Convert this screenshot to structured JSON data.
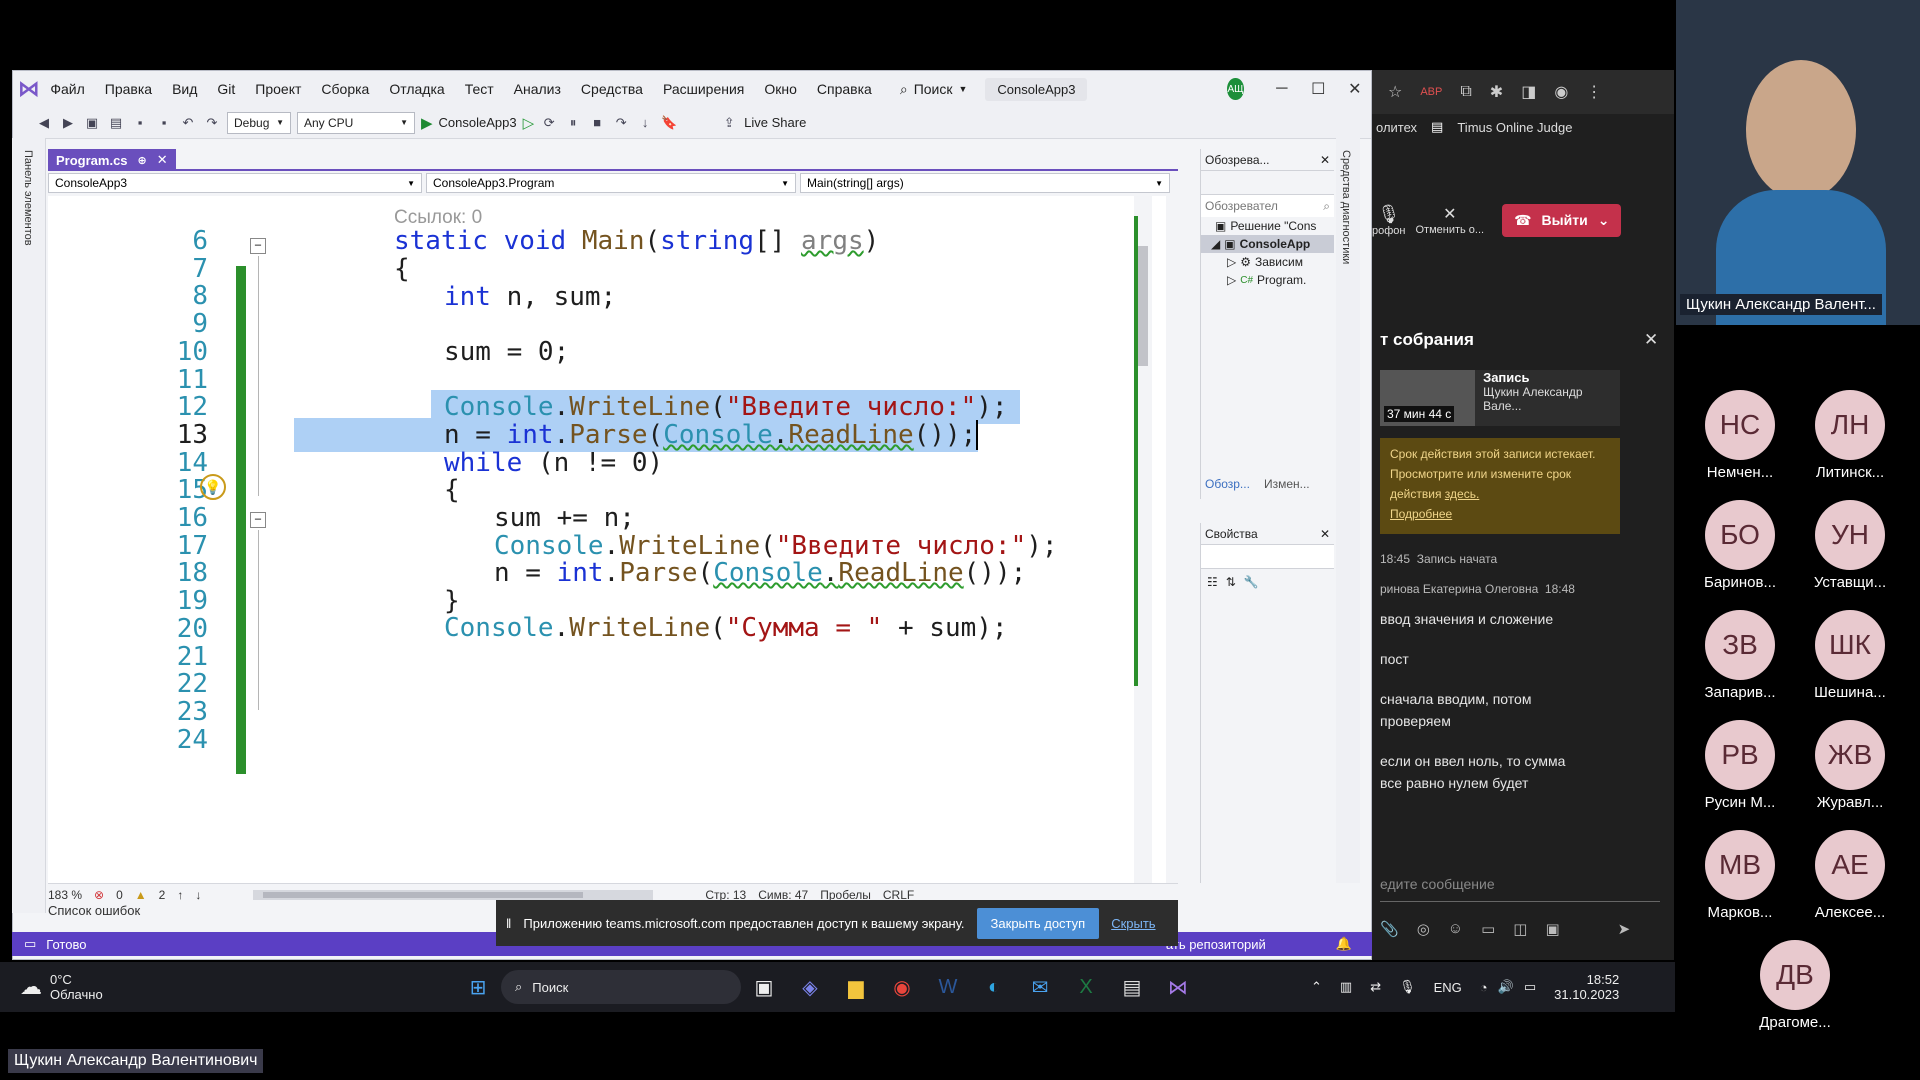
{
  "vs": {
    "menu": [
      "Файл",
      "Правка",
      "Вид",
      "Git",
      "Проект",
      "Сборка",
      "Отладка",
      "Тест",
      "Анализ",
      "Средства",
      "Расширения",
      "Окно",
      "Справка"
    ],
    "search_label": "Поиск",
    "project_title": "ConsoleApp3",
    "user_initials": "АЩ",
    "toolbar": {
      "config": "Debug",
      "platform": "Any CPU",
      "run_target": "ConsoleApp3",
      "live_share": "Live Share"
    },
    "left_strip_label": "Панель элементов",
    "right_strip_label": "Средства диагностики",
    "doc_tab": "Program.cs",
    "nav": {
      "project": "ConsoleApp3",
      "class": "ConsoleApp3.Program",
      "member": "Main(string[] args)"
    },
    "codelens": "Ссылок: 0",
    "line_numbers": [
      "6",
      "7",
      "8",
      "9",
      "10",
      "11",
      "12",
      "13",
      "14",
      "15",
      "16",
      "17",
      "18",
      "19",
      "20",
      "21",
      "22",
      "23",
      "24"
    ],
    "editor_status": {
      "zoom": "183 %",
      "errors": "0",
      "warnings": "2",
      "line": "Стр: 13",
      "col": "Симв: 47",
      "spaces": "Пробелы",
      "eol": "CRLF"
    },
    "error_list": "Список ошибок",
    "status_ready": "Готово",
    "status_repo": "ать репозиторий",
    "solution_explorer": {
      "title": "Обозрева...",
      "search": "Обозревател",
      "items": [
        "Решение \"Cons",
        "ConsoleApp",
        "Зависим",
        "Program."
      ],
      "tabs": [
        "Обозр...",
        "Измен..."
      ]
    },
    "properties": {
      "title": "Свойства"
    }
  },
  "share_banner": {
    "text": "Приложению teams.microsoft.com предоставлен доступ к вашему экрану.",
    "stop": "Закрыть доступ",
    "hide": "Скрыть"
  },
  "taskbar": {
    "weather_temp": "0°C",
    "weather_desc": "Облачно",
    "search": "Поиск",
    "lang": "ENG",
    "time": "18:52",
    "date": "31.10.2023"
  },
  "teams": {
    "bookmarks": [
      "олитех",
      "Timus Online Judge"
    ],
    "mic_label": "рофон",
    "cancel_label": "Отменить о...",
    "leave": "Выйти",
    "panel_title": "т собрания",
    "recording_title": "Запись",
    "recording_author": "Щукин Александр Вале...",
    "recording_duration": "37 мин 44 с",
    "expiry_text": "Срок действия этой записи истекает. Просмотрите или измените срок действия",
    "expiry_link": "здесь.",
    "more_link": "Подробнее",
    "rec_time": "18:45",
    "rec_started": "Запись начата",
    "chat_author": "ринова Екатерина Олеговна",
    "chat_time": "18:48",
    "messages": [
      "ввод значения и сложение",
      "пост",
      "сначала вводим, потом проверяем",
      "если он ввел ноль, то сумма все равно нулем будет"
    ],
    "compose_placeholder": "едите сообщение"
  },
  "participants": {
    "speaker": "Щукин Александр Валент...",
    "list": [
      {
        "initials": "НС",
        "name": "Немчен..."
      },
      {
        "initials": "ЛН",
        "name": "Литинск..."
      },
      {
        "initials": "БО",
        "name": "Баринов..."
      },
      {
        "initials": "УН",
        "name": "Уставщи..."
      },
      {
        "initials": "ЗВ",
        "name": "Запарив..."
      },
      {
        "initials": "ШК",
        "name": "Шешина..."
      },
      {
        "initials": "РВ",
        "name": "Русин М..."
      },
      {
        "initials": "ЖВ",
        "name": "Журавл..."
      },
      {
        "initials": "МВ",
        "name": "Марков..."
      },
      {
        "initials": "АЕ",
        "name": "Алексее..."
      },
      {
        "initials": "ДВ",
        "name": "Драгоме..."
      }
    ],
    "bottom_name": "Щукин Александр Валентинович"
  },
  "colors": {
    "vs_accent": "#6a4fbd",
    "status_bar": "#5b3fc4",
    "leave_red": "#c4314b",
    "avatar_pink": "#e8c9ce"
  }
}
